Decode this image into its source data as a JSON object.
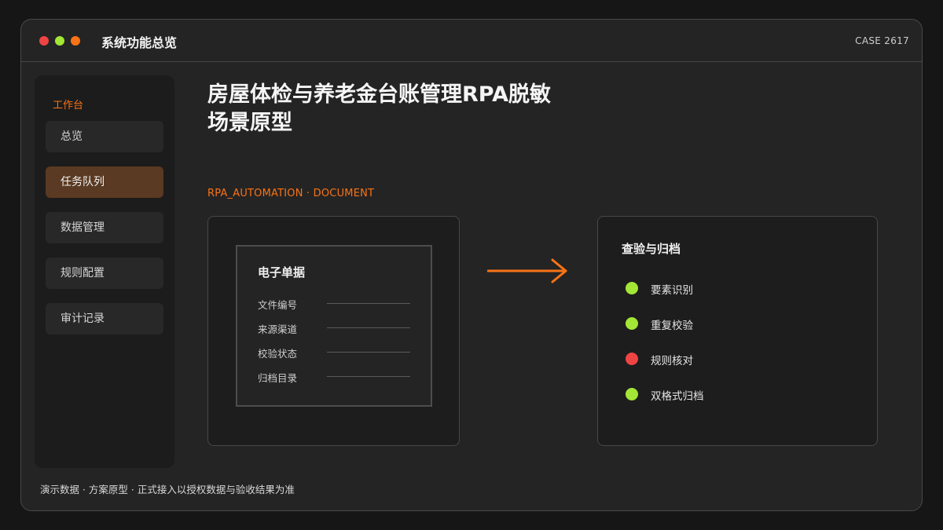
{
  "window": {
    "title": "系统功能总览",
    "case_id": "CASE 2617",
    "controls": [
      {
        "name": "close",
        "color": "#ef4444"
      },
      {
        "name": "minimize",
        "color": "#a3e635"
      },
      {
        "name": "maximize",
        "color": "#f97316"
      }
    ]
  },
  "sidebar": {
    "heading": "工作台",
    "items": [
      {
        "label": "总览",
        "active": false
      },
      {
        "label": "任务队列",
        "active": true
      },
      {
        "label": "数据管理",
        "active": false
      },
      {
        "label": "规则配置",
        "active": false
      },
      {
        "label": "审计记录",
        "active": false
      }
    ]
  },
  "main": {
    "title_line1": "房屋体检与养老金台账管理RPA脱敏",
    "title_line2": "场景原型",
    "tag": "RPA_AUTOMATION · DOCUMENT",
    "document": {
      "title": "电子单据",
      "fields": [
        "文件编号",
        "来源渠道",
        "校验状态",
        "归档目录"
      ]
    },
    "arrow_icon": "arrow-right-icon",
    "archive": {
      "title": "查验与归档",
      "items": [
        {
          "label": "要素识别",
          "status": "ok",
          "color": "#a3e635"
        },
        {
          "label": "重复校验",
          "status": "ok",
          "color": "#a3e635"
        },
        {
          "label": "规则核对",
          "status": "error",
          "color": "#ef4444"
        },
        {
          "label": "双格式归档",
          "status": "ok",
          "color": "#a3e635"
        }
      ]
    }
  },
  "footer": "演示数据 · 方案原型 · 正式接入以授权数据与验收结果为准",
  "colors": {
    "accent": "#f97316",
    "ok": "#a3e635",
    "error": "#ef4444",
    "active_nav": "#5a3a22"
  }
}
